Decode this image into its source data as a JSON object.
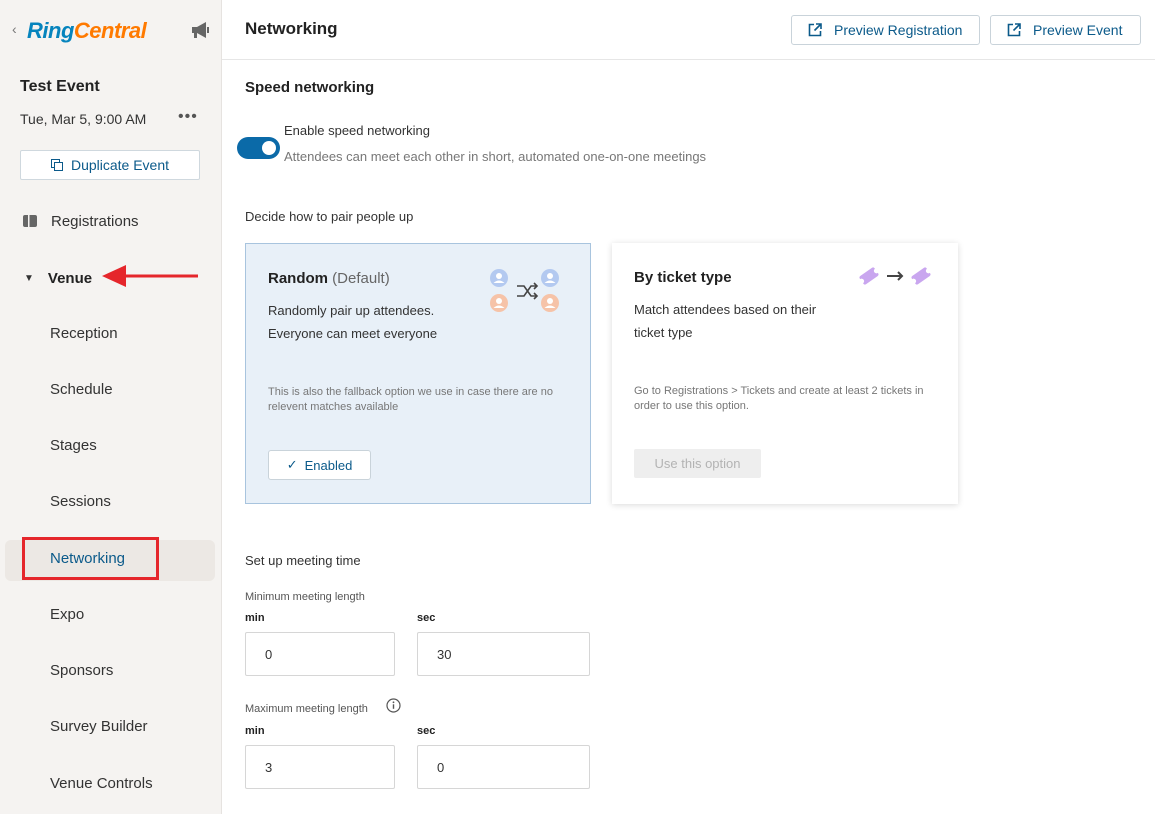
{
  "sidebar": {
    "brand": {
      "part1": "Ring",
      "part2": "Central"
    },
    "event_title": "Test Event",
    "event_date": "Tue, Mar 5, 9:00 AM",
    "more_label": "•••",
    "duplicate_label": "Duplicate Event",
    "registrations_label": "Registrations",
    "venue_label": "Venue",
    "venue_items": [
      "Reception",
      "Schedule",
      "Stages",
      "Sessions",
      "Networking",
      "Expo",
      "Sponsors",
      "Survey Builder",
      "Venue Controls"
    ],
    "active_item": "Networking"
  },
  "header": {
    "title": "Networking",
    "preview_registration": "Preview Registration",
    "preview_event": "Preview Event"
  },
  "speed": {
    "title": "Speed networking",
    "toggle_label": "Enable speed networking",
    "toggle_desc": "Attendees can meet each other in short, automated one-on-one meetings",
    "toggle_on": true
  },
  "pairing": {
    "label": "Decide how to pair people up",
    "random": {
      "title": "Random",
      "default_tag": "(Default)",
      "desc": "Randomly pair up attendees. Everyone can meet everyone",
      "note": "This is also the fallback option we use in case there are no relevent matches available",
      "button": "Enabled"
    },
    "ticket": {
      "title": "By ticket type",
      "desc": "Match attendees based on their ticket type",
      "note": "Go to Registrations > Tickets and create at least 2 tickets in order to use this option.",
      "button": "Use this option"
    }
  },
  "meeting": {
    "title": "Set up meeting time",
    "min_label": "Minimum meeting length",
    "max_label": "Maximum meeting length",
    "unit_min": "min",
    "unit_sec": "sec",
    "min_value_min": "0",
    "min_value_sec": "30",
    "max_value_min": "3",
    "max_value_sec": "0"
  },
  "colors": {
    "primary": "#0b6aa8",
    "link": "#0b5a8a",
    "annotation_red": "#e5262b",
    "brand_blue": "#0684bd",
    "brand_orange": "#ff7a00"
  }
}
